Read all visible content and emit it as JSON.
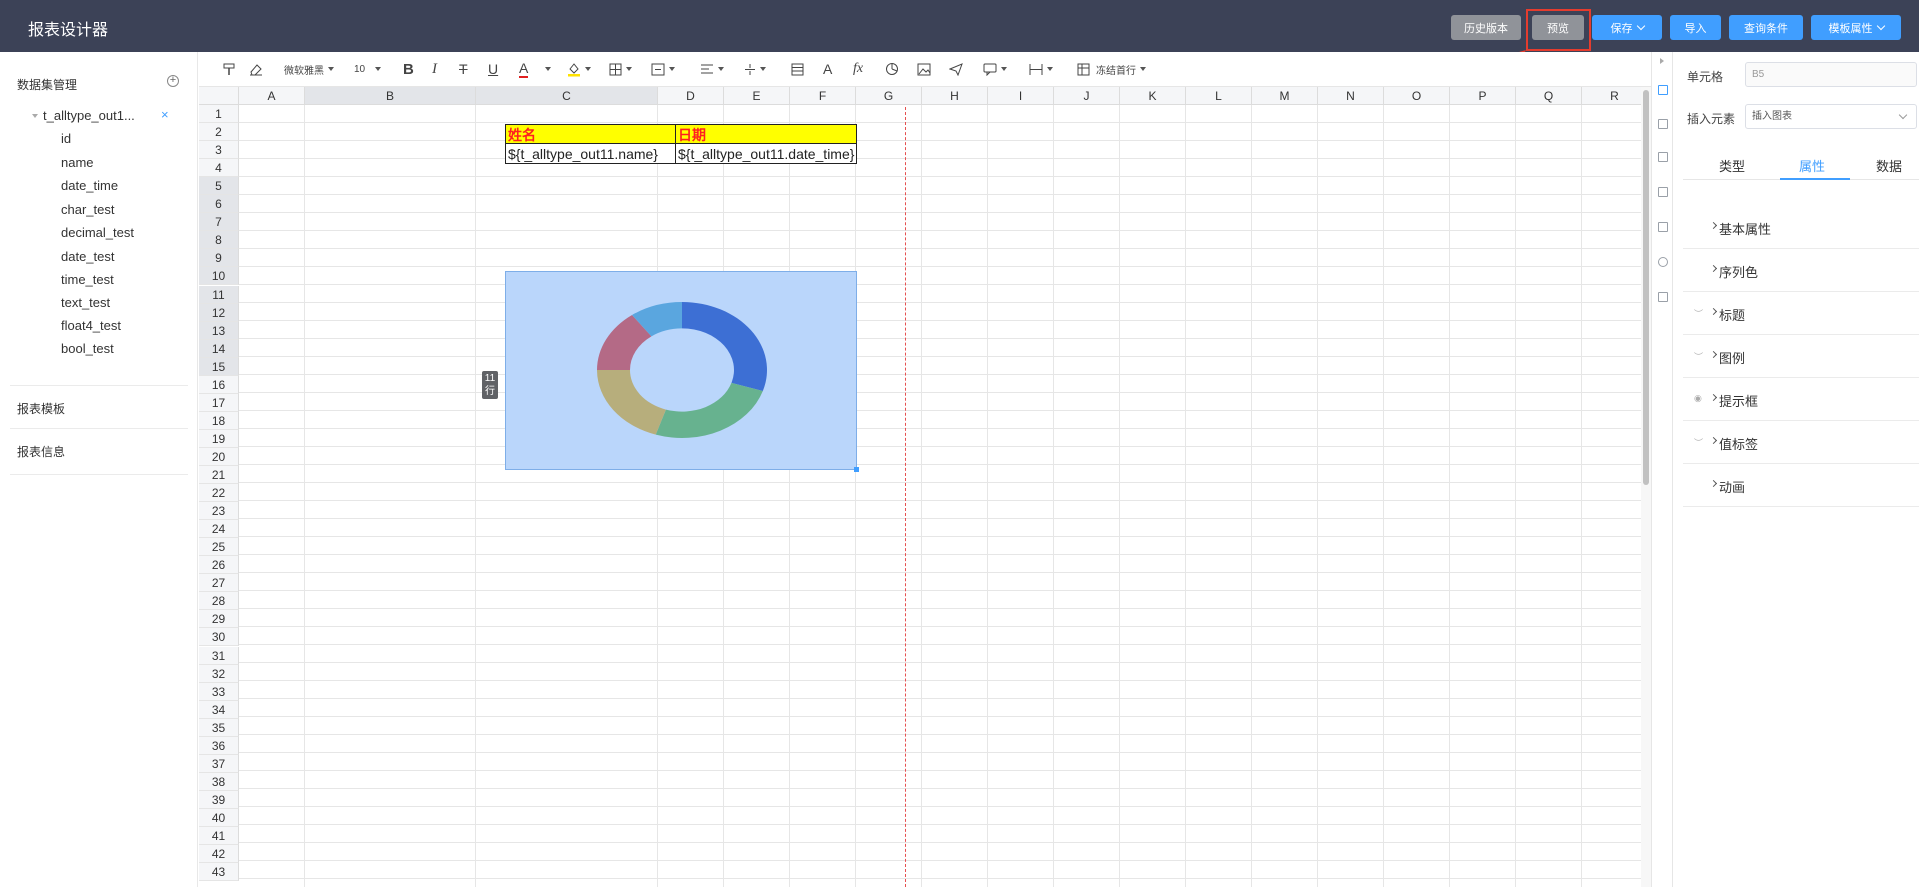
{
  "header": {
    "title": "报表设计器",
    "buttons": {
      "history": "历史版本",
      "preview": "预览",
      "save": "保存",
      "import": "导入",
      "query": "查询条件",
      "template_props": "模板属性"
    }
  },
  "left": {
    "dataset_title": "数据集管理",
    "add_symbol": "+",
    "dataset_name": "t_alltype_out1...",
    "close_symbol": "×",
    "fields": [
      "id",
      "name",
      "date_time",
      "char_test",
      "decimal_test",
      "date_test",
      "time_test",
      "text_test",
      "float4_test",
      "bool_test"
    ],
    "sections": [
      "报表模板",
      "报表信息"
    ]
  },
  "toolbar": {
    "font": "微软雅黑",
    "size": "10",
    "freeze": "冻结首行"
  },
  "sheet": {
    "columns": [
      "A",
      "B",
      "C",
      "D",
      "E",
      "F",
      "G",
      "H",
      "I",
      "J",
      "K",
      "L",
      "M",
      "N",
      "O",
      "P",
      "Q",
      "R"
    ],
    "row_count": 43,
    "cells": {
      "b2": "姓名",
      "c2": "日期",
      "b3": "${t_alltype_out11.name}",
      "c3": "${t_alltype_out11.date_time}"
    },
    "row_tag": "11行",
    "chart": {
      "type": "pie",
      "slices": [
        {
          "value": 30,
          "color": "#3d6fd4"
        },
        {
          "value": 25,
          "color": "#67b28f"
        },
        {
          "value": 20,
          "color": "#b7ae7c"
        },
        {
          "value": 15,
          "color": "#b46a86"
        },
        {
          "value": 10,
          "color": "#5aa6df"
        }
      ]
    }
  },
  "right": {
    "cell_label": "单元格",
    "cell_value": "B5",
    "insert_label": "插入元素",
    "insert_value": "插入图表",
    "tabs": [
      "类型",
      "属性",
      "数据"
    ],
    "props": [
      "基本属性",
      "序列色",
      "标题",
      "图例",
      "提示框",
      "值标签",
      "动画"
    ]
  },
  "colors": {
    "header_bg": "#3c4257",
    "accent": "#409eff",
    "highlight": "#e53c2e",
    "cell_header_bg": "#ffff00",
    "cell_header_text": "#ff2020"
  }
}
